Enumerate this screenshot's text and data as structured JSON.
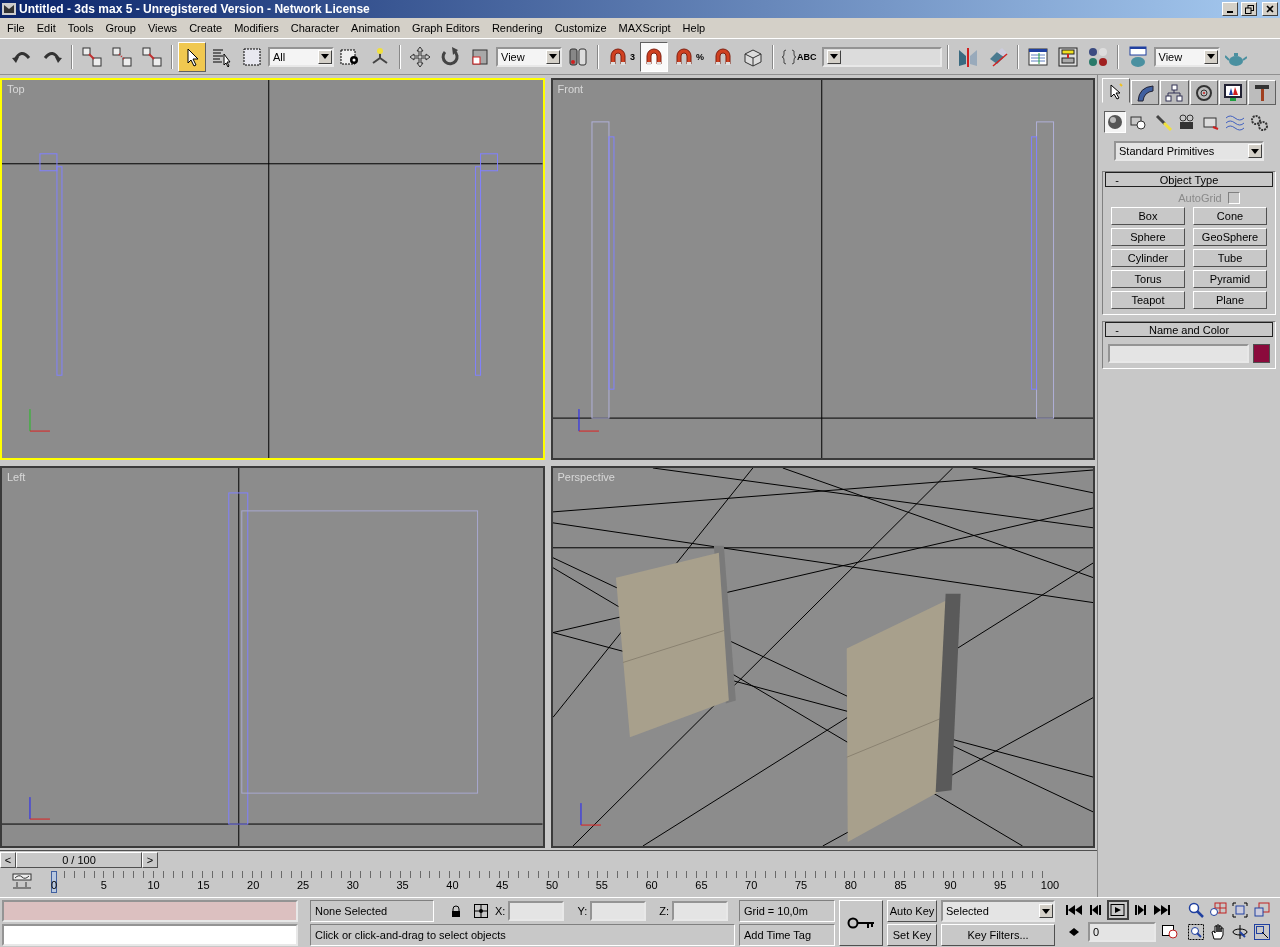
{
  "window": {
    "title": "Untitled - 3ds max 5 - Unregistered Version - Network License"
  },
  "menu": [
    "File",
    "Edit",
    "Tools",
    "Group",
    "Views",
    "Create",
    "Modifiers",
    "Character",
    "Animation",
    "Graph Editors",
    "Rendering",
    "Customize",
    "MAXScript",
    "Help"
  ],
  "toolbar": [
    {
      "kind": "undo",
      "selected": false
    },
    {
      "kind": "redo",
      "selected": false
    },
    {
      "kind": "separator"
    },
    {
      "kind": "link",
      "selected": false
    },
    {
      "kind": "unlink",
      "selected": false
    },
    {
      "kind": "bind",
      "selected": false
    },
    {
      "kind": "separator"
    },
    {
      "kind": "select",
      "selected": true
    },
    {
      "kind": "select-by-name",
      "selected": false
    },
    {
      "kind": "region-select",
      "selected": false
    },
    {
      "kind": "dropdown",
      "value": "All"
    },
    {
      "kind": "window-crossing",
      "selected": false
    },
    {
      "kind": "manipulate",
      "selected": false
    },
    {
      "kind": "separator"
    },
    {
      "kind": "move",
      "selected": false
    },
    {
      "kind": "rotate",
      "selected": false
    },
    {
      "kind": "scale",
      "selected": false
    },
    {
      "kind": "dropdown",
      "value": "View"
    },
    {
      "kind": "pivot",
      "selected": false
    },
    {
      "kind": "separator"
    },
    {
      "kind": "snap",
      "label": "3",
      "selected": false
    },
    {
      "kind": "angle-snap",
      "selected": true
    },
    {
      "kind": "percent-snap",
      "label": "%",
      "selected": false
    },
    {
      "kind": "spinner-snap",
      "selected": false
    },
    {
      "kind": "keyboard",
      "selected": false
    },
    {
      "kind": "separator"
    },
    {
      "kind": "named-selection",
      "label": "ABC",
      "selected": false
    },
    {
      "kind": "dropdown"
    },
    {
      "kind": "separator"
    },
    {
      "kind": "mirror",
      "selected": false
    },
    {
      "kind": "align",
      "selected": false
    },
    {
      "kind": "separator"
    },
    {
      "kind": "track-view",
      "selected": false
    },
    {
      "kind": "schematic",
      "selected": false
    },
    {
      "kind": "material",
      "selected": false
    },
    {
      "kind": "separator"
    },
    {
      "kind": "render-scene",
      "selected": false
    },
    {
      "kind": "dropdown",
      "value": "View"
    },
    {
      "kind": "quick-render",
      "selected": false
    }
  ],
  "viewports": [
    {
      "label": "Top",
      "kind": "top",
      "active": true
    },
    {
      "label": "Front",
      "kind": "front",
      "active": false
    },
    {
      "label": "Left",
      "kind": "left",
      "active": false
    },
    {
      "label": "Perspective",
      "kind": "perspective",
      "active": false
    }
  ],
  "command_panel": {
    "tabs": [
      {
        "kind": "create",
        "selected": true
      },
      {
        "kind": "modify",
        "selected": false
      },
      {
        "kind": "hierarchy",
        "selected": false
      },
      {
        "kind": "motion",
        "selected": false
      },
      {
        "kind": "display",
        "selected": false
      },
      {
        "kind": "utilities",
        "selected": false
      }
    ],
    "categories": [
      {
        "kind": "geometry",
        "selected": true
      },
      {
        "kind": "shapes",
        "selected": false
      },
      {
        "kind": "lights",
        "selected": false
      },
      {
        "kind": "cameras",
        "selected": false
      },
      {
        "kind": "helpers",
        "selected": false
      },
      {
        "kind": "space-warps",
        "selected": false
      },
      {
        "kind": "systems",
        "selected": false
      }
    ],
    "dropdown": "Standard Primitives",
    "object_type": {
      "toggle": "-",
      "title": "Object Type",
      "autogrid": {
        "label": "AutoGrid",
        "checked": false,
        "disabled": true
      },
      "buttons": [
        "Box",
        "Cone",
        "Sphere",
        "GeoSphere",
        "Cylinder",
        "Tube",
        "Torus",
        "Pyramid",
        "Teapot",
        "Plane"
      ]
    },
    "name_and_color": {
      "toggle": "-",
      "title": "Name and Color",
      "color": "#8b0a3c"
    }
  },
  "time_slider": {
    "prev": "<",
    "next": ">",
    "thumb": "0 / 100",
    "level": 0
  },
  "track_bar": {
    "ticks": [
      "0",
      "5",
      "10",
      "15",
      "20",
      "25",
      "30",
      "35",
      "40",
      "45",
      "50",
      "55",
      "60",
      "65",
      "70",
      "75",
      "80",
      "85",
      "90",
      "95",
      "100"
    ]
  },
  "status": {
    "selection": "None Selected",
    "x_label": "X:",
    "y_label": "Y:",
    "z_label": "Z:",
    "grid": "Grid = 10,0m",
    "prompt": "Click or click-and-drag to select objects",
    "time_tag": "Add Time Tag",
    "auto_key": {
      "label": "Auto Key",
      "on": false
    },
    "set_key": "Set Key",
    "key_mode": "Selected",
    "key_filters": "Key Filters...",
    "playback": [
      {
        "kind": "start",
        "selected": false
      },
      {
        "kind": "prev",
        "selected": false
      },
      {
        "kind": "play",
        "selected": true
      },
      {
        "kind": "next",
        "selected": false
      },
      {
        "kind": "end",
        "selected": false
      }
    ],
    "frame": "0"
  }
}
